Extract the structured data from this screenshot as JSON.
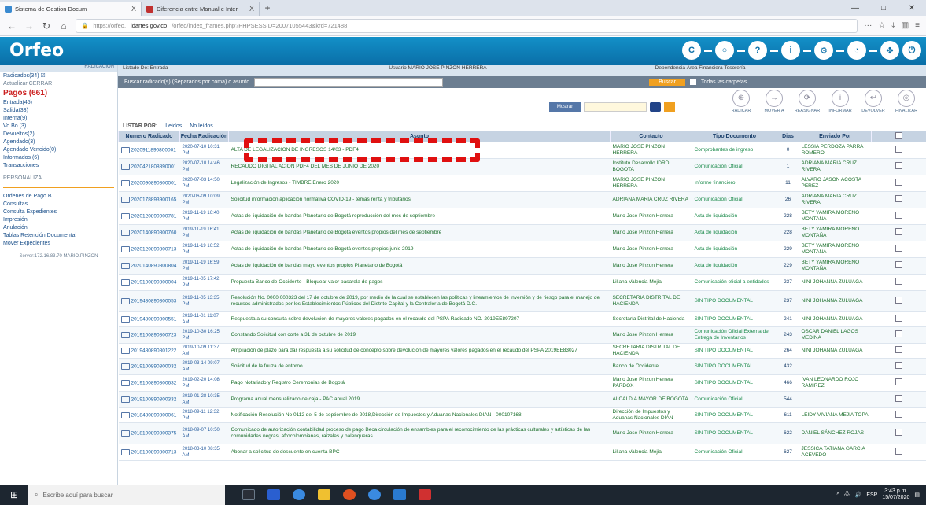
{
  "browser": {
    "tabs": [
      {
        "label": "Sistema de Gestion Docum",
        "close": "X",
        "active": true
      },
      {
        "label": "Diferencia entre Manual e Inter",
        "close": "X",
        "active": false
      }
    ],
    "new_tab": "+",
    "url_prefix": "https://orfeo.",
    "url_domain": "idartes.gov.co",
    "url_rest": "/orfeo/index_frames.php?PHPSESSID=20071055443&krd=721488",
    "window": {
      "minimize": "—",
      "maximize": "□",
      "close": "✕"
    }
  },
  "app": {
    "logo": "Orfeo",
    "left": {
      "header": "RADICACION",
      "items": [
        {
          "label": "Radicados(34) ☑",
          "style": "normal"
        },
        {
          "label": "Actualizar       CERRAR",
          "style": "sm"
        },
        {
          "label": "Pagos (661)",
          "style": "red"
        },
        {
          "label": "Entrada(45)",
          "style": "normal"
        },
        {
          "label": "Salida(33)",
          "style": "normal"
        },
        {
          "label": "Interna(9)",
          "style": "normal"
        },
        {
          "label": "Vo.Bo.(3)",
          "style": "normal"
        },
        {
          "label": "Devueltos(2)",
          "style": "normal"
        },
        {
          "label": "Agendado(3)",
          "style": "normal"
        },
        {
          "label": "Agendado Vencido(0)",
          "style": "normal"
        },
        {
          "label": "Informados (6)",
          "style": "normal"
        },
        {
          "label": "Transacciones",
          "style": "normal"
        },
        {
          "label": "PERSONALIZA",
          "style": "sm"
        }
      ],
      "items2": [
        {
          "label": "Ordenes de Pago B"
        },
        {
          "label": "Consultas"
        },
        {
          "label": "Consulta Expedientes"
        },
        {
          "label": "Impresión"
        },
        {
          "label": "Anulación"
        },
        {
          "label": "Tablas Retención Documental"
        },
        {
          "label": "Mover Expedientes"
        }
      ],
      "footer": "Server:172.16.83.70 MARIO.PINZON"
    },
    "info": {
      "c1": "Listado De: Entrada",
      "c2": "Usuario MARIO JOSE PINZON HERRERA",
      "c3": "Dependencia Área Financiera Tesorería"
    },
    "search": {
      "label": "Buscar radicado(s) (Separados por coma) o asunto",
      "button": "Buscar",
      "all_label": "Todas las carpetas"
    },
    "controls": {
      "blue": "Mostrar"
    },
    "actions": [
      "RADICAR",
      "MOVER A",
      "REASIGNAR",
      "INFORMAR",
      "DEVOLVER",
      "FINALIZAR"
    ],
    "list": {
      "label": "LISTAR POR:",
      "opt1": "Leídos",
      "opt2": "No leídos"
    },
    "table": {
      "headers": [
        "Numero Radicado",
        "Fecha Radicación",
        "Asunto",
        "Contacto",
        "Tipo Documento",
        "Dias",
        "Enviado Por",
        ""
      ],
      "rows": [
        [
          "2020911890800001",
          "2020-07-10 10:31 PM",
          "ALTA DE LEGALIZACION DE INGRESOS 14/03 - PDF4",
          "MARIO JOSE PINZON HERRERA",
          "Comprobantes de ingreso",
          "0",
          "LESSIA PERDOZA PARRA ROMERO"
        ],
        [
          "2020421808890001",
          "2020-07-10 14:46 PM",
          "RECAUDO DIGITAL ACION PDF4 DEL MES DE JUNIO DE 2020",
          "Instituto Desarrollo IDRD BOGOTA",
          "Comunicación Oficial",
          "1",
          "ADRIANA MARIA CRUZ RIVERA"
        ],
        [
          "2020090890800001",
          "2020-07-03 14:50 PM",
          "Legalización de Ingresos - TIMBRE Enero 2020",
          "MARIO JOSE PINZON HERRERA",
          "Informe financiero",
          "11",
          "ALVARO JASON ACOSTA PEREZ"
        ],
        [
          "2020178893900165",
          "2020-06-09 10:09 PM",
          "Solicitud información aplicación normativa COVID-19 - temas renta y tributarios",
          "ADRIANA MARIA CRUZ RIVERA",
          "Comunicación Oficial",
          "26",
          "ADRIANA MARIA CRUZ RIVERA"
        ],
        [
          "2020120890900781",
          "2019-11-19 16:40 PM",
          "Actas de liquidación de bandas Planetario de Bogotá reproducción del mes de septiembre",
          "Mario Jose Pinzon Herrera",
          "Acta de liquidación",
          "228",
          "BETY YAMIRA MORENO MONTAÑA"
        ],
        [
          "2020140890800760",
          "2019-11-19 16:41 PM",
          "Actas de liquidación de bandas Planetario de Bogotá eventos propios del mes de septiembre",
          "Mario Jose Pinzon Herrera",
          "Acta de liquidación",
          "228",
          "BETY YAMIRA MORENO MONTAÑA"
        ],
        [
          "2020120890800713",
          "2019-11-19 16:52 PM",
          "Actas de liquidación de bandas Planetario de Bogotá eventos propios junio 2019",
          "Mario Jose Pinzon Herrera",
          "Acta de liquidación",
          "229",
          "BETY YAMIRA MORENO MONTAÑA"
        ],
        [
          "2020140890800804",
          "2019-11-19 16:59 PM",
          "Actas de liquidación de bandas mayo eventos propios Planetario de Bogotá",
          "Mario Jose Pinzon Herrera",
          "Acta de liquidación",
          "229",
          "BETY YAMIRA MORENO MONTAÑA"
        ],
        [
          "2019100890800004",
          "2019-11-05 17:42 PM",
          "Propuesta Banco de Occidente - Bloquear valor pasarela de pagos",
          "Liliana Valencia Mejia",
          "Comunicación oficial a entidades",
          "237",
          "NINI JOHANNA ZULUAGA"
        ],
        [
          "2019480890800053",
          "2019-11-05 13:35 PM",
          "Resolución No. 0000 000323 del 17 de octubre de 2019, por medio de la cual se establecen las políticas y lineamientos de inversión y de riesgo para el manejo de recursos administrados por los Establecimientos Públicos del Distrito Capital y la Contraloría de Bogotá D.C.",
          "SECRETARIA DISTRITAL DE HACIENDA",
          "SIN TIPO DOCUMENTAL",
          "237",
          "NINI JOHANNA ZULUAGA"
        ],
        [
          "2019480890800551",
          "2019-11-01 11:07 AM",
          "Respuesta a su consulta sobre devolución de mayores valores pagados en el recaudo del PSPA Radicado NO. 2019EE897207",
          "Secretaría Distrital de Hacienda",
          "SIN TIPO DOCUMENTAL",
          "241",
          "NINI JOHANNA ZULUAGA"
        ],
        [
          "2019100890800723",
          "2019-10-30 16:25 PM",
          "Constando Solicitud con corte a 31 de octubre de 2019",
          "Mario Jose Pinzon Herrera",
          "Comunicación Oficial Externa de Entrega de Inventarios",
          "243",
          "OSCAR DANIEL LAGOS MEDINA"
        ],
        [
          "2019480890801222",
          "2019-10-09 11:37 AM",
          "Ampliación de plazo para dar respuesta a su solicitud de concepto sobre devolución de mayores valores pagados en el recaudo del PSPA 2019EE83027",
          "SECRETARIA DISTRITAL DE HACIENDA",
          "SIN TIPO DOCUMENTAL",
          "264",
          "NINI JOHANNA ZULUAGA"
        ],
        [
          "2019100890800032",
          "2019-03-14 09:07 AM",
          "Solicitud de la fuuza de entorno",
          "Banco de Occidente",
          "SIN TIPO DOCUMENTAL",
          "432",
          ""
        ],
        [
          "2019100890800632",
          "2019-02-20 14:08 PM",
          "Pago Notariado y Registro Ceremonias de Bogotá",
          "Mario Jose Pinzon Herrera PARDOX",
          "SIN TIPO DOCUMENTAL",
          "466",
          "IVAN LEONARDO ROJO RAMIREZ"
        ],
        [
          "2019100890800332",
          "2019-01-28 10:35 AM",
          "Programa anual mensualizado de caja - PAC anual 2019",
          "ALCALDIA MAYOR DE BOGOTA",
          "Comunicación Oficial",
          "544",
          ""
        ],
        [
          "2018480890800061",
          "2018-09-11 12:32 PM",
          "Notificación Resolución No 0112 del 5 de septiembre de 2018,Dirección de Impuestos y Aduanas Nacionales DIAN - 000107168",
          "Dirección de Impuestos y Aduanas Nacionales DIAN",
          "SIN TIPO DOCUMENTAL",
          "611",
          "LEIDY VIVIANA MEJIA TOPA"
        ],
        [
          "2018100890800375",
          "2018-09-07 10:50 AM",
          "Comunicado de autorización contabilidad proceso de pago Beca circulación de ensambles para el reconocimiento de las prácticas culturales y artísticas de las comunidades negras, afrocolombianas, raizales y palenqueras",
          "Mario Jose Pinzon Herrera",
          "SIN TIPO DOCUMENTAL",
          "622",
          "DANIEL SÁNCHEZ ROJAS"
        ],
        [
          "2018100890800713",
          "2018-03-10 08:35 AM",
          "Abonar a solicitud de descuento en cuenta BPC",
          "Liliana Valencia Mejia",
          "Comunicación Oficial",
          "627",
          "JESSICA TATIANA GARCIA ACEVEDO"
        ]
      ]
    }
  },
  "taskbar": {
    "search": "Escribe aquí para buscar",
    "time": "3:43 p.m.",
    "date": "15/07/2020",
    "lang": "ESP"
  }
}
